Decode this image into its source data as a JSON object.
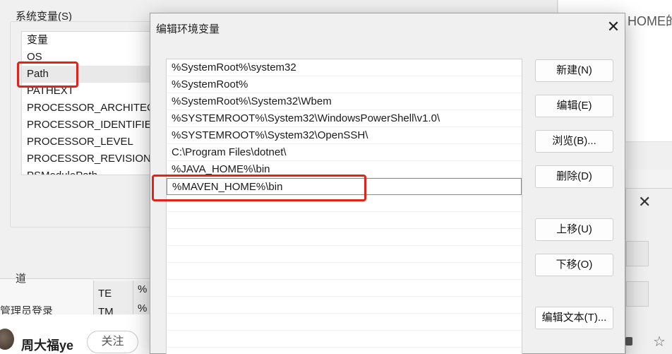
{
  "system_vars": {
    "group_title": "系统变量(S)",
    "items": [
      {
        "label": "变量"
      },
      {
        "label": "OS"
      },
      {
        "label": "Path"
      },
      {
        "label": "PATHEXT"
      },
      {
        "label": "PROCESSOR_ARCHITECT"
      },
      {
        "label": "PROCESSOR_IDENTIFIER"
      },
      {
        "label": "PROCESSOR_LEVEL"
      },
      {
        "label": "PROCESSOR_REVISION"
      },
      {
        "label": "PSModulePath"
      }
    ],
    "selected_index": 2
  },
  "background": {
    "frag_top": "道",
    "frag_bottom": "管理员登录",
    "table_cells": [
      "TE",
      "TM",
      "%",
      "%"
    ],
    "right_title_fragment": "HOME的"
  },
  "author": {
    "name": "周大福ye",
    "follow_label": "关注"
  },
  "dialog": {
    "title": "编辑环境变量",
    "close_symbol": "✕",
    "paths": [
      "%SystemRoot%\\system32",
      "%SystemRoot%",
      "%SystemRoot%\\System32\\Wbem",
      "%SYSTEMROOT%\\System32\\WindowsPowerShell\\v1.0\\",
      "%SYSTEMROOT%\\System32\\OpenSSH\\",
      "C:\\Program Files\\dotnet\\",
      "%JAVA_HOME%\\bin",
      "%MAVEN_HOME%\\bin"
    ],
    "editing_index": 7,
    "empty_rows": 10,
    "buttons": {
      "new": "新建(N)",
      "edit": "编辑(E)",
      "browse": "浏览(B)...",
      "delete": "删除(D)",
      "move_up": "上移(U)",
      "move_down": "下移(O)",
      "edit_text": "编辑文本(T)..."
    }
  },
  "colors": {
    "highlight_box": "#e0241b",
    "dialog_bg": "#f0f0f0",
    "list_bg": "#ffffff"
  }
}
